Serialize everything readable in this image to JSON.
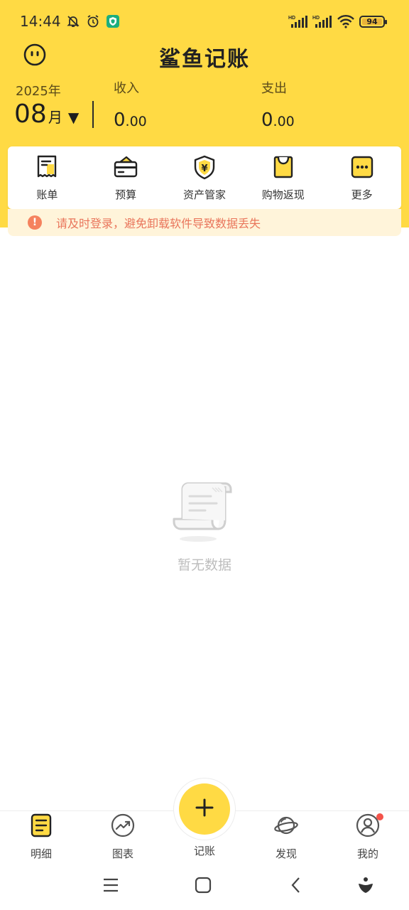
{
  "status_bar": {
    "time": "14:44",
    "battery": "94",
    "icons": [
      "mute-bell-icon",
      "alarm-icon",
      "vpn-shield-icon",
      "hd-signal-icon",
      "hd-signal-icon",
      "wifi-icon",
      "battery-icon"
    ]
  },
  "header": {
    "title": "鲨鱼记账",
    "profile_icon": "face-icon"
  },
  "summary": {
    "year": "2025年",
    "month": "08",
    "month_unit": "月",
    "dropdown_icon": "caret-down-icon",
    "income_label": "收入",
    "income_int": "0",
    "income_dec": ".00",
    "expense_label": "支出",
    "expense_int": "0",
    "expense_dec": ".00"
  },
  "quick_menu": [
    {
      "label": "账单",
      "icon": "bill-icon"
    },
    {
      "label": "预算",
      "icon": "budget-wallet-icon"
    },
    {
      "label": "资产管家",
      "icon": "asset-shield-icon"
    },
    {
      "label": "购物返现",
      "icon": "shopping-bag-icon"
    },
    {
      "label": "更多",
      "icon": "more-dots-icon"
    }
  ],
  "notice": {
    "icon": "alert-icon",
    "text": "请及时登录，避免卸载软件导致数据丢失"
  },
  "empty_state": {
    "icon": "empty-receipt-icon",
    "text": "暂无数据"
  },
  "bottom_nav": [
    {
      "label": "明细",
      "icon": "detail-list-icon"
    },
    {
      "label": "图表",
      "icon": "chart-trend-icon"
    },
    {
      "label": "记账",
      "icon": "plus-icon"
    },
    {
      "label": "发现",
      "icon": "planet-icon"
    },
    {
      "label": "我的",
      "icon": "user-icon"
    }
  ],
  "colors": {
    "brand_yellow": "#FFDA44",
    "notice_bg": "#FFF4DA",
    "notice_text": "#E9755B",
    "badge_red": "#F4534A"
  }
}
